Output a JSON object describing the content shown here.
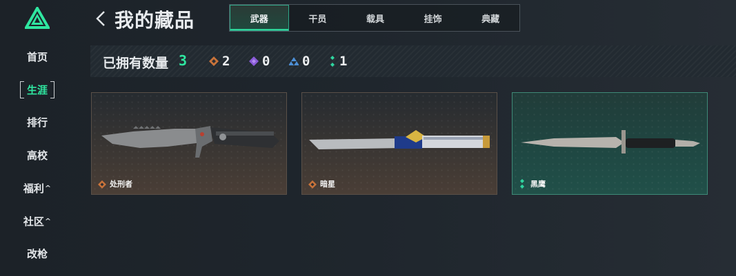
{
  "sidebar": {
    "items": [
      {
        "label": "首页",
        "caret": ""
      },
      {
        "label": "生涯",
        "caret": ""
      },
      {
        "label": "排行",
        "caret": ""
      },
      {
        "label": "高校",
        "caret": ""
      },
      {
        "label": "福利",
        "caret": "^"
      },
      {
        "label": "社区",
        "caret": "^"
      },
      {
        "label": "改枪",
        "caret": ""
      }
    ],
    "active_index": 1,
    "accent": "#2fe6a0"
  },
  "header": {
    "title": "我的藏品",
    "tabs": [
      "武器",
      "干员",
      "载具",
      "挂饰",
      "典藏"
    ],
    "active_tab": 0
  },
  "summary": {
    "owned_label": "已拥有数量",
    "owned_count": "3",
    "rarities": [
      {
        "icon": "orange-diamond-icon",
        "color": "#c8733a",
        "count": "2"
      },
      {
        "icon": "purple-diamond-icon",
        "color": "#8a5bd8",
        "count": "0"
      },
      {
        "icon": "blue-triangle-icon",
        "color": "#4c8fd6",
        "count": "0"
      },
      {
        "icon": "green-dots-icon",
        "color": "#2fd5a0",
        "count": "1"
      }
    ]
  },
  "collection": {
    "items": [
      {
        "name": "处刑者",
        "rarity_icon": "orange-diamond-icon"
      },
      {
        "name": "暗星",
        "rarity_icon": "orange-diamond-icon"
      },
      {
        "name": "黑鹰",
        "rarity_icon": "green-dots-icon"
      }
    ]
  }
}
